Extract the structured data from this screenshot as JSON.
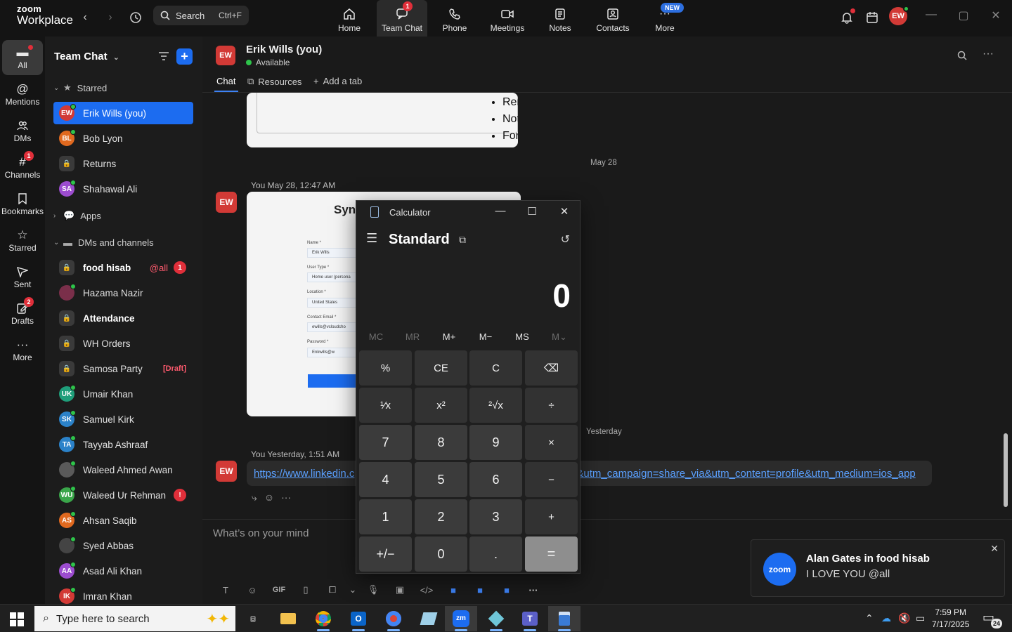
{
  "app": {
    "logo_line1": "zoom",
    "logo_line2": "Workplace",
    "search_label": "Search",
    "search_shortcut": "Ctrl+F",
    "user_initials": "EW"
  },
  "topnav": [
    {
      "label": "Home",
      "icon": "home-icon",
      "badge": ""
    },
    {
      "label": "Team Chat",
      "icon": "chat-icon",
      "badge": "1"
    },
    {
      "label": "Phone",
      "icon": "phone-icon",
      "badge": ""
    },
    {
      "label": "Meetings",
      "icon": "video-icon",
      "badge": ""
    },
    {
      "label": "Notes",
      "icon": "notes-icon",
      "badge": ""
    },
    {
      "label": "Contacts",
      "icon": "contacts-icon",
      "badge": ""
    },
    {
      "label": "More",
      "icon": "more-icon",
      "badge": "NEW"
    }
  ],
  "rail": [
    {
      "label": "All",
      "icon": "chat-bubble-icon",
      "badge": ""
    },
    {
      "label": "Mentions",
      "icon": "at-icon",
      "badge": ""
    },
    {
      "label": "DMs",
      "icon": "people-icon",
      "badge": ""
    },
    {
      "label": "Channels",
      "icon": "hash-icon",
      "badge": "1"
    },
    {
      "label": "Bookmarks",
      "icon": "bookmark-icon",
      "badge": ""
    },
    {
      "label": "Starred",
      "icon": "star-icon",
      "badge": ""
    },
    {
      "label": "Sent",
      "icon": "send-icon",
      "badge": ""
    },
    {
      "label": "Drafts",
      "icon": "draft-icon",
      "badge": "2"
    },
    {
      "label": "More",
      "icon": "more-icon",
      "badge": ""
    }
  ],
  "sidebar": {
    "title": "Team Chat",
    "starred_label": "Starred",
    "apps_label": "Apps",
    "dms_label": "DMs and channels",
    "starred": [
      {
        "name": "Erik Wills (you)",
        "initials": "EW",
        "color": "#d23a36",
        "kind": "avatar",
        "selected": true
      },
      {
        "name": "Bob Lyon",
        "initials": "BL",
        "color": "#e0691f",
        "kind": "avatar"
      },
      {
        "name": "Returns",
        "kind": "lock"
      },
      {
        "name": "Shahawal Ali",
        "initials": "SA",
        "color": "#9c4ccf",
        "kind": "avatar"
      }
    ],
    "dms": [
      {
        "name": "food hisab",
        "kind": "lock",
        "bold": true,
        "mention": "@all",
        "count": "1"
      },
      {
        "name": "Hazama Nazir",
        "initials": "",
        "color": "#7a2f4a",
        "kind": "avatar"
      },
      {
        "name": "Attendance",
        "kind": "lock",
        "bold": true
      },
      {
        "name": "WH Orders",
        "kind": "lock"
      },
      {
        "name": "Samosa Party",
        "kind": "lock",
        "draft": "[Draft]"
      },
      {
        "name": "Umair Khan",
        "initials": "UK",
        "color": "#1f9e7a",
        "kind": "avatar"
      },
      {
        "name": "Samuel Kirk",
        "initials": "SK",
        "color": "#2b82c9",
        "kind": "avatar"
      },
      {
        "name": "Tayyab Ashraaf",
        "initials": "TA",
        "color": "#2b82c9",
        "kind": "avatar"
      },
      {
        "name": "Waleed Ahmed Awan",
        "initials": "",
        "color": "#5a5a5a",
        "kind": "avatar"
      },
      {
        "name": "Waleed Ur Rehman",
        "initials": "WU",
        "color": "#3aa64a",
        "kind": "avatar",
        "alert": "!"
      },
      {
        "name": "Ahsan Saqib",
        "initials": "AS",
        "color": "#e0691f",
        "kind": "avatar"
      },
      {
        "name": "Syed Abbas",
        "initials": "",
        "color": "#444444",
        "kind": "avatar"
      },
      {
        "name": "Asad Ali Khan",
        "initials": "AA",
        "color": "#9c4ccf",
        "kind": "avatar"
      },
      {
        "name": "Imran Khan",
        "initials": "IK",
        "color": "#d23a36",
        "kind": "avatar"
      }
    ]
  },
  "chat": {
    "header_initials": "EW",
    "header_name": "Erik Wills (you)",
    "header_status": "Available",
    "tabs": [
      "Chat",
      "Resources",
      "Add a tab"
    ],
    "card_bullets": [
      "Remo",
      "Note t",
      "For m"
    ],
    "date_1": "May 28",
    "msg1_meta": "You May 28, 12:47 AM",
    "msg_initials": "EW",
    "form_title": "Sync",
    "form_fields": [
      {
        "label": "Name *",
        "value": "Erik Wills"
      },
      {
        "label": "User Type *",
        "value": "Home user (persona"
      },
      {
        "label": "Location *",
        "value": "United States"
      },
      {
        "label": "Contact Email *",
        "value": "ewills@vcloudcho"
      },
      {
        "label": "Password *",
        "value": "Enkwills@w"
      }
    ],
    "date_2": "Yesterday",
    "msg2_meta": "You Yesterday, 1:51 AM",
    "link_left": "https://www.linkedin.c",
    "link_right": "&utm_campaign=share_via&utm_content=profile&utm_medium=ios_app",
    "composer_placeholder": "What’s on your mind"
  },
  "toast": {
    "logo": "zoom",
    "title": "Alan Gates in food hisab",
    "body": "I LOVE YOU @all"
  },
  "calculator": {
    "window_title": "Calculator",
    "mode": "Standard",
    "display": "0",
    "memory": [
      {
        "label": "MC",
        "enabled": false
      },
      {
        "label": "MR",
        "enabled": false
      },
      {
        "label": "M+",
        "enabled": true
      },
      {
        "label": "M−",
        "enabled": true
      },
      {
        "label": "MS",
        "enabled": true
      },
      {
        "label": "M⌄",
        "enabled": false
      }
    ],
    "keys": [
      [
        "%",
        "CE",
        "C",
        "⌫"
      ],
      [
        "¹⁄x",
        "x²",
        "²√x",
        "÷"
      ],
      [
        "7",
        "8",
        "9",
        "×"
      ],
      [
        "4",
        "5",
        "6",
        "−"
      ],
      [
        "1",
        "2",
        "3",
        "+"
      ],
      [
        "+/−",
        "0",
        ".",
        "="
      ]
    ]
  },
  "taskbar": {
    "search_placeholder": "Type here to search",
    "time": "7:59 PM",
    "date": "7/17/2025",
    "notif_count": "24"
  }
}
